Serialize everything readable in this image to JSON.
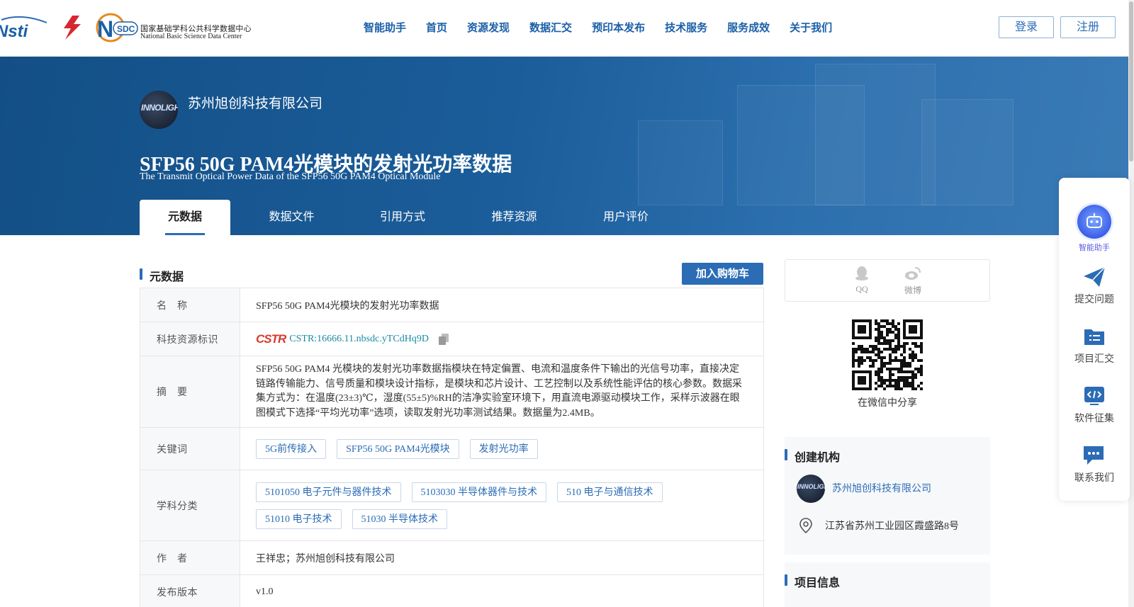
{
  "header": {
    "logo_nsti": "Nsti",
    "logo_nsdc_cn": "国家基础学科公共科学数据中心",
    "logo_nsdc_en": "National Basic Science Data Center",
    "nav": [
      "智能助手",
      "首页",
      "资源发现",
      "数据汇交",
      "预印本发布",
      "技术服务",
      "服务成效",
      "关于我们"
    ],
    "login": "登录",
    "register": "注册"
  },
  "banner": {
    "company_logo_text": "INNOLIGHT",
    "company_name": "苏州旭创科技有限公司",
    "title_zh": "SFP56 50G PAM4光模块的发射光功率数据",
    "title_en": "The Transmit Optical Power Data of the SFP56 50G PAM4 Optical Module",
    "tabs": [
      "元数据",
      "数据文件",
      "引用方式",
      "推荐资源",
      "用户评价"
    ]
  },
  "metadata": {
    "section_title": "元数据",
    "cart_button": "加入购物车",
    "rows": {
      "name": {
        "label": "名　称",
        "value": "SFP56 50G PAM4光模块的发射光功率数据"
      },
      "cstr": {
        "label": "科技资源标识",
        "logo": "CSTR",
        "value": "CSTR:16666.11.nbsdc.yTCdHq9D"
      },
      "abstract": {
        "label": "摘　要",
        "value": "SFP56 50G PAM4 光模块的发射光功率数据指模块在特定偏置、电流和温度条件下输出的光信号功率，直接决定链路传输能力、信号质量和模块设计指标，是模块和芯片设计、工艺控制以及系统性能评估的核心参数。数据采集方式为：在温度(23±3)℃，湿度(55±5)%RH的洁净实验室环境下，用直流电源驱动模块工作，采样示波器在眼图模式下选择“平均光功率”选项，读取发射光功率测试结果。数据量为2.4MB。"
      },
      "keywords": {
        "label": "关键词",
        "tags": [
          "5G前传接入",
          "SFP56 50G PAM4光模块",
          "发射光功率"
        ]
      },
      "subjects": {
        "label": "学科分类",
        "tags": [
          "5101050 电子元件与器件技术",
          "5103030 半导体器件与技术",
          "510 电子与通信技术",
          "51010 电子技术",
          "51030 半导体技术"
        ]
      },
      "authors": {
        "label": "作　者",
        "value": "王祥忠；苏州旭创科技有限公司"
      },
      "version": {
        "label": "发布版本",
        "value": "v1.0"
      }
    }
  },
  "share": {
    "qq": "QQ",
    "weibo": "微博",
    "wechat_text": "在微信中分享"
  },
  "org": {
    "section_title": "创建机构",
    "logo_text": "INNOLIGHT",
    "name": "苏州旭创科技有限公司",
    "address": "江苏省苏州工业园区霞盛路8号"
  },
  "project": {
    "section_title": "项目信息"
  },
  "sidebar": {
    "items": [
      "智能助手",
      "提交问题",
      "项目汇交",
      "软件征集",
      "联系我们"
    ]
  },
  "colors": {
    "primary": "#2b6cb5",
    "banner": "#1b5d9a",
    "cstr_red": "#d83b2e"
  }
}
